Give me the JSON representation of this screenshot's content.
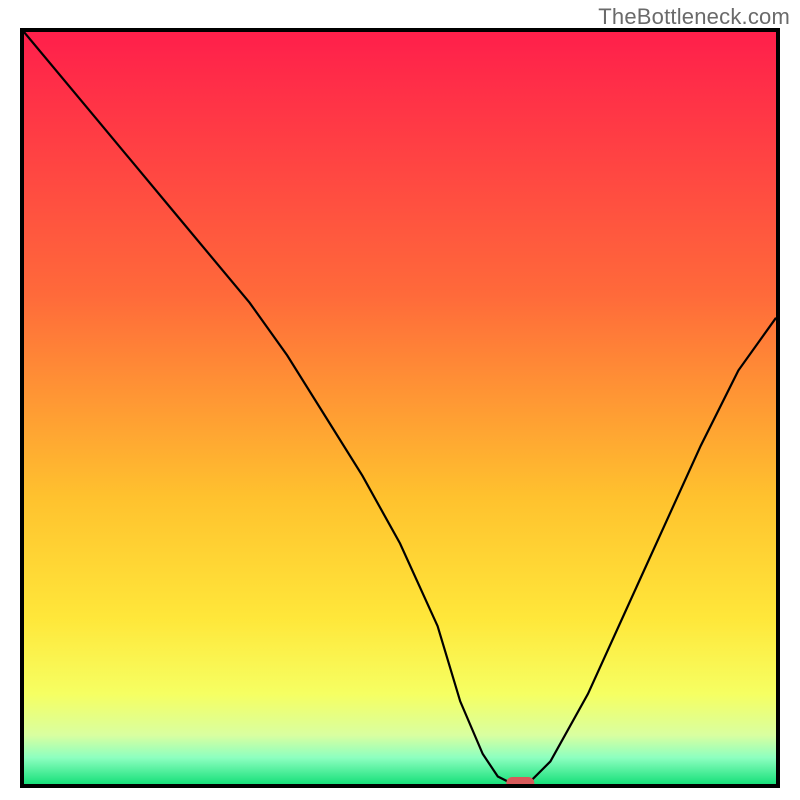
{
  "watermark": "TheBottleneck.com",
  "chart_data": {
    "type": "line",
    "title": "",
    "xlabel": "",
    "ylabel": "",
    "xlim": [
      0,
      100
    ],
    "ylim": [
      0,
      100
    ],
    "x": [
      0,
      10,
      20,
      30,
      35,
      40,
      45,
      50,
      55,
      58,
      61,
      63,
      65,
      67,
      70,
      75,
      80,
      85,
      90,
      95,
      100
    ],
    "values": [
      100,
      88,
      76,
      64,
      57,
      49,
      41,
      32,
      21,
      11,
      4,
      1,
      0,
      0,
      3,
      12,
      23,
      34,
      45,
      55,
      62
    ],
    "marker": {
      "x": 66,
      "y": 0,
      "color": "#d75a5a"
    },
    "gradient_stops": [
      {
        "offset": 0,
        "color": "#ff1f4b"
      },
      {
        "offset": 0.35,
        "color": "#ff6a3a"
      },
      {
        "offset": 0.62,
        "color": "#ffc22e"
      },
      {
        "offset": 0.78,
        "color": "#ffe73a"
      },
      {
        "offset": 0.88,
        "color": "#f6ff62"
      },
      {
        "offset": 0.935,
        "color": "#d9ffa0"
      },
      {
        "offset": 0.965,
        "color": "#8dffc0"
      },
      {
        "offset": 1.0,
        "color": "#18e07a"
      }
    ]
  }
}
